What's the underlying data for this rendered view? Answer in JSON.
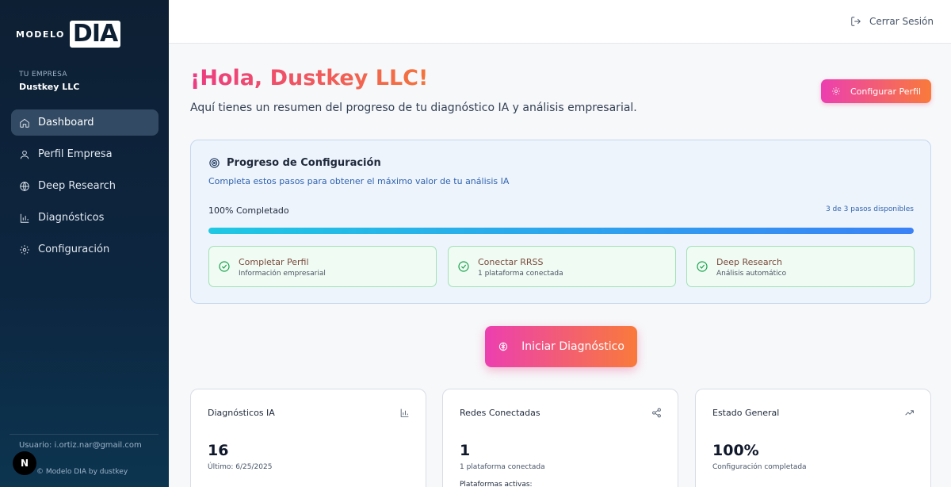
{
  "sidebar": {
    "logo_text": "MODELO",
    "logo_mark": "DIA",
    "company_label": "TU EMPRESA",
    "company_name": "Dustkey LLC",
    "items": [
      {
        "label": "Dashboard",
        "icon": "home-icon",
        "active": true
      },
      {
        "label": "Perfil Empresa",
        "icon": "user-icon"
      },
      {
        "label": "Deep Research",
        "icon": "globe-icon"
      },
      {
        "label": "Diagnósticos",
        "icon": "bar-chart-icon"
      },
      {
        "label": "Configuración",
        "icon": "gear-icon"
      }
    ],
    "user_line": "Usuario: i.ortiz.nar@gmail.com",
    "footer": "© Modelo DIA by dustkey",
    "badge": "N"
  },
  "topbar": {
    "logout_label": "Cerrar Sesión"
  },
  "main": {
    "greeting": "¡Hola, Dustkey LLC!",
    "subtitle": "Aquí tienes un resumen del progreso de tu diagnóstico IA y análisis empresarial.",
    "config_button": "Configurar Perfil",
    "start_button": "Iniciar Diagnóstico"
  },
  "progress": {
    "title": "Progreso de Configuración",
    "subtitle": "Completa estos pasos para obtener el máximo valor de tu análisis IA",
    "percent_label": "100% Completado",
    "steps_label": "3 de 3 pasos disponibles",
    "fill_percent": 100,
    "steps": [
      {
        "title": "Completar Perfil",
        "desc": "Información empresarial"
      },
      {
        "title": "Conectar RRSS",
        "desc": "1 plataforma conectada"
      },
      {
        "title": "Deep Research",
        "desc": "Análisis automático"
      }
    ]
  },
  "stats": [
    {
      "title": "Diagnósticos IA",
      "value": "16",
      "sub": "Último: 6/25/2025",
      "extra": "",
      "icon": "bar-chart-icon"
    },
    {
      "title": "Redes Conectadas",
      "value": "1",
      "sub": "1 plataforma conectada",
      "extra": "Plataformas activas:",
      "icon": "share-icon"
    },
    {
      "title": "Estado General",
      "value": "100%",
      "sub": "Configuración completada",
      "extra": "",
      "icon": "trending-up-icon"
    }
  ],
  "colors": {
    "sidebar_bg": "#0d1f33",
    "accent_pink": "#ec3fb0",
    "accent_orange": "#f97a3b",
    "progress_blue": "#3b82f6",
    "success_green": "#16a34a"
  }
}
